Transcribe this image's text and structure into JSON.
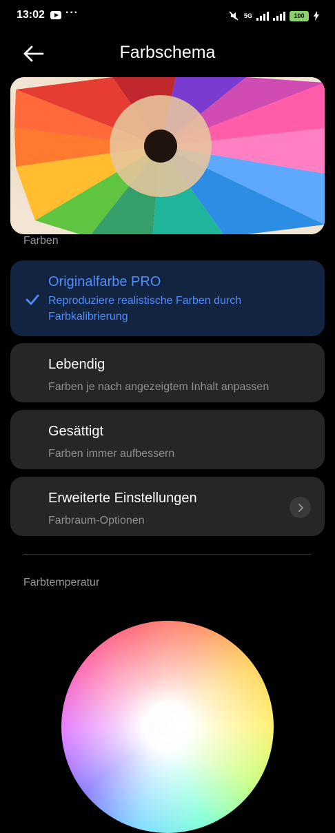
{
  "status_bar": {
    "time": "13:02",
    "dots": "···",
    "network": "5G",
    "battery": "100"
  },
  "header": {
    "title": "Farbschema"
  },
  "sections": {
    "colors_label": "Farben",
    "temperature_label": "Farbtemperatur"
  },
  "options": [
    {
      "title": "Originalfarbe PRO",
      "subtitle": "Reproduziere realistische Farben durch Farbkalibrierung",
      "selected": true
    },
    {
      "title": "Lebendig",
      "subtitle": "Farben je nach angezeigtem Inhalt anpassen",
      "selected": false
    },
    {
      "title": "Gesättigt",
      "subtitle": "Farben immer aufbessern",
      "selected": false
    },
    {
      "title": "Erweiterte Einstellungen",
      "subtitle": "Farbraum-Optionen",
      "selected": false
    }
  ],
  "icons": {
    "back": "back-arrow-icon",
    "check": "check-icon",
    "chevron": "chevron-right-icon",
    "app": "youtube-icon"
  },
  "colors": {
    "accent": "#4f8dff",
    "card": "#262626",
    "selected_card": "#132441",
    "background": "#000000"
  }
}
